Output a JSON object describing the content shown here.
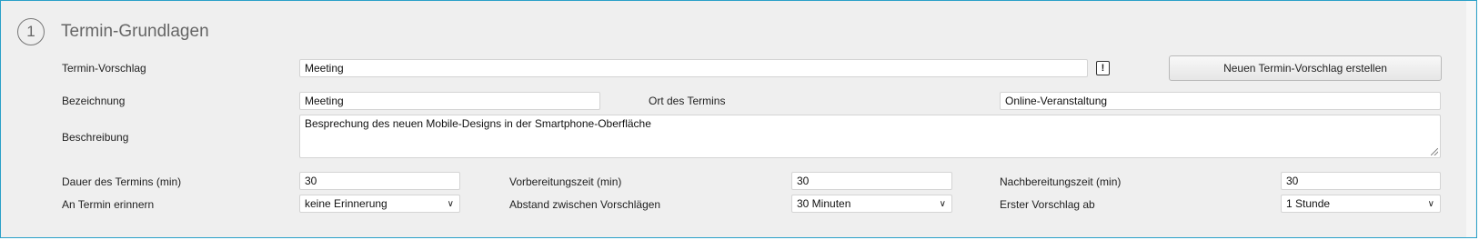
{
  "section": {
    "step": "1",
    "title": "Termin-Grundlagen"
  },
  "vorschlag": {
    "label": "Termin-Vorschlag",
    "value": "Meeting",
    "alert_icon": "!",
    "create_button": "Neuen Termin-Vorschlag erstellen"
  },
  "bezeichnung": {
    "label": "Bezeichnung",
    "value": "Meeting"
  },
  "ort": {
    "label": "Ort des Termins",
    "value": "Online-Veranstaltung"
  },
  "beschreibung": {
    "label": "Beschreibung",
    "value": "Besprechung des neuen Mobile-Designs in der Smartphone-Oberfläche"
  },
  "dauer": {
    "label": "Dauer des Termins (min)",
    "value": "30"
  },
  "vorbereitung": {
    "label": "Vorbereitungszeit (min)",
    "value": "30"
  },
  "nachbereitung": {
    "label": "Nachbereitungszeit (min)",
    "value": "30"
  },
  "erinnern": {
    "label": "An Termin erinnern",
    "selected": "keine Erinnerung"
  },
  "abstand": {
    "label": "Abstand zwischen Vorschlägen",
    "selected": "30 Minuten"
  },
  "erster": {
    "label": "Erster Vorschlag ab",
    "selected": "1 Stunde"
  }
}
